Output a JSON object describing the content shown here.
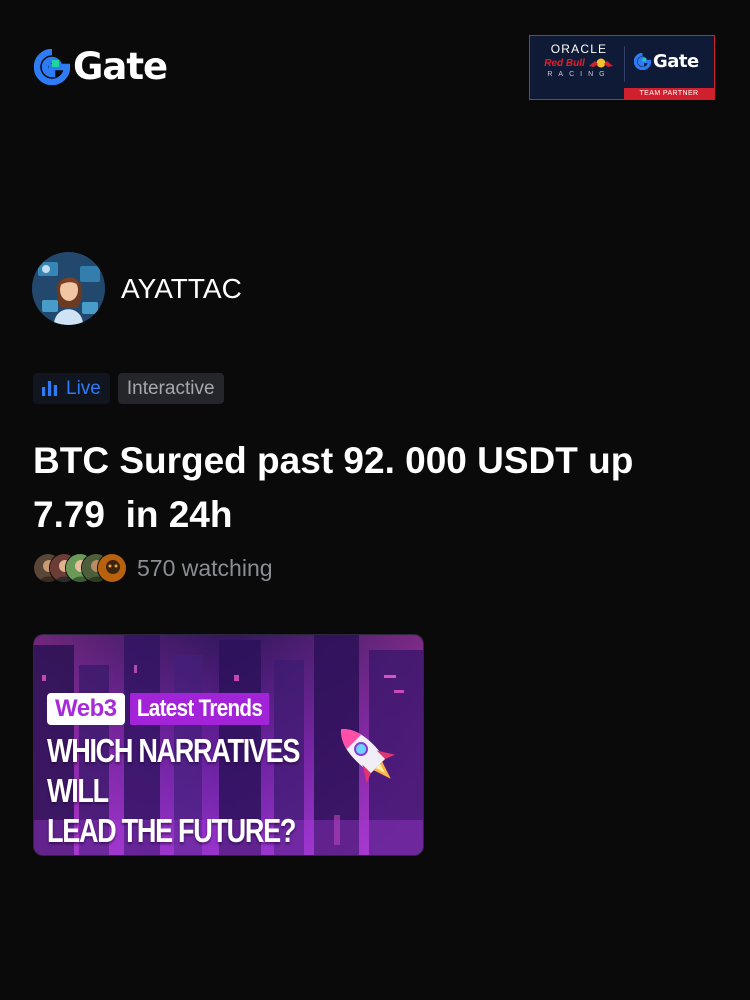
{
  "header": {
    "brand_name": "Gate",
    "partner": {
      "oracle": "ORACLE",
      "red_bull": "Red Bull",
      "racing": "RACING",
      "gate": "Gate",
      "team_partner": "TEAM PARTNER"
    }
  },
  "host": {
    "name": "AYATTAC"
  },
  "tags": {
    "live": "Live",
    "interactive": "Interactive"
  },
  "stream": {
    "title": "BTC Surged past 92. 000 USDT up\n7.79  in 24h",
    "watching": "570 watching"
  },
  "thumbnail": {
    "badge_web3": "Web3",
    "badge_trends": "Latest Trends",
    "headline": "WHICH NARRATIVES WILL\nLEAD THE FUTURE?"
  },
  "colors": {
    "background": "#0a0a0b",
    "gate_blue": "#2d7cf6",
    "gate_green": "#1fd49e",
    "live_blue": "#2d7cf6",
    "card_purple": "#a324d8",
    "partner_red": "#d0202e",
    "partner_navy": "#0f1b36"
  },
  "icons": {
    "logo": "gate-logo-icon",
    "live": "bar-chart-icon",
    "rocket": "rocket-icon"
  }
}
